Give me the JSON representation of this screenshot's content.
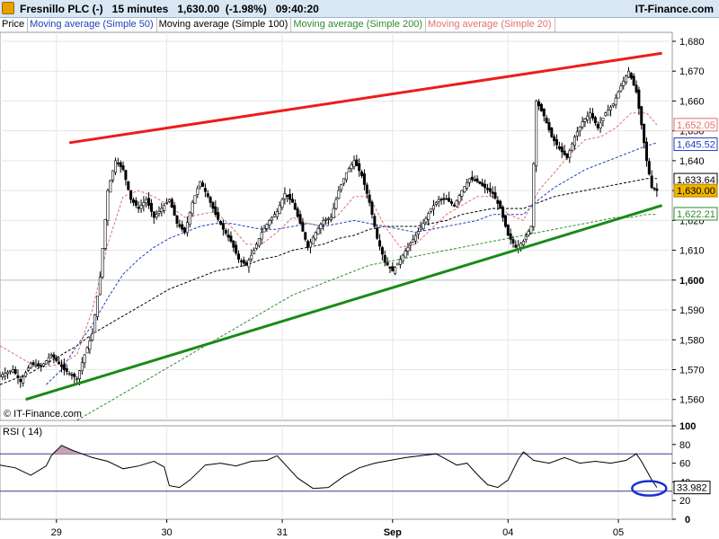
{
  "header": {
    "title": "Fresnillo PLC (-)   15 minutes   1,630.00  (-1.98%)   09:40:20",
    "brand": "IT-Finance.com"
  },
  "legend": [
    {
      "label": "Price",
      "color": "#000000"
    },
    {
      "label": "Moving average (Simple 50)",
      "color": "#1f3fbf"
    },
    {
      "label": "Moving average (Simple 100)",
      "color": "#000000"
    },
    {
      "label": "Moving average (Simple 200)",
      "color": "#2e8b2e"
    },
    {
      "label": "Moving average (Simple 20)",
      "color": "#e07070"
    }
  ],
  "watermark": "© IT-Finance.com",
  "chart_data": [
    {
      "type": "candlestick",
      "ylim": [
        1553,
        1683
      ],
      "y_ticks": [
        "1,560",
        "1,570",
        "1,580",
        "1,590",
        "1,600",
        "1,610",
        "1,620",
        "1,630",
        "1,640",
        "1,650",
        "1,660",
        "1,670",
        "1,680"
      ],
      "x_ticks": [
        "29",
        "30",
        "31",
        "Sep",
        "04",
        "05"
      ],
      "grid": true,
      "price_labels": [
        {
          "text": "1,652.05",
          "color": "#e07070"
        },
        {
          "text": "1,645.52",
          "color": "#1f3fbf"
        },
        {
          "text": "1,633.64",
          "color": "#000000"
        },
        {
          "text": "1,630.00",
          "color": "#000000",
          "bg": "#f0b400"
        },
        {
          "text": "1,622.21",
          "color": "#2e8b2e"
        }
      ],
      "price_path": [
        [
          0,
          1568
        ],
        [
          5,
          1570
        ],
        [
          8,
          1566
        ],
        [
          12,
          1572
        ],
        [
          16,
          1571
        ],
        [
          20,
          1575
        ],
        [
          25,
          1570
        ],
        [
          30,
          1567
        ],
        [
          33,
          1575
        ],
        [
          36,
          1582
        ],
        [
          39,
          1601
        ],
        [
          42,
          1630
        ],
        [
          45,
          1640
        ],
        [
          48,
          1637
        ],
        [
          51,
          1627
        ],
        [
          54,
          1624
        ],
        [
          57,
          1627
        ],
        [
          60,
          1621
        ],
        [
          63,
          1624
        ],
        [
          66,
          1627
        ],
        [
          69,
          1619
        ],
        [
          72,
          1616
        ],
        [
          75,
          1626
        ],
        [
          78,
          1633
        ],
        [
          81,
          1628
        ],
        [
          84,
          1622
        ],
        [
          87,
          1617
        ],
        [
          90,
          1613
        ],
        [
          93,
          1607
        ],
        [
          96,
          1605
        ],
        [
          99,
          1610
        ],
        [
          102,
          1616
        ],
        [
          105,
          1620
        ],
        [
          108,
          1623
        ],
        [
          111,
          1629
        ],
        [
          114,
          1626
        ],
        [
          117,
          1619
        ],
        [
          120,
          1611
        ],
        [
          123,
          1616
        ],
        [
          126,
          1620
        ],
        [
          129,
          1621
        ],
        [
          132,
          1630
        ],
        [
          135,
          1636
        ],
        [
          138,
          1640
        ],
        [
          141,
          1635
        ],
        [
          144,
          1626
        ],
        [
          147,
          1614
        ],
        [
          150,
          1606
        ],
        [
          153,
          1603
        ],
        [
          156,
          1607
        ],
        [
          159,
          1611
        ],
        [
          162,
          1615
        ],
        [
          165,
          1619
        ],
        [
          168,
          1624
        ],
        [
          171,
          1627
        ],
        [
          174,
          1627
        ],
        [
          177,
          1625
        ],
        [
          180,
          1630
        ],
        [
          183,
          1634
        ],
        [
          186,
          1633
        ],
        [
          189,
          1631
        ],
        [
          192,
          1629
        ],
        [
          195,
          1624
        ],
        [
          198,
          1615
        ],
        [
          201,
          1611
        ],
        [
          204,
          1613
        ],
        [
          207,
          1618
        ],
        [
          209,
          1660
        ],
        [
          212,
          1655
        ],
        [
          215,
          1648
        ],
        [
          218,
          1644
        ],
        [
          221,
          1641
        ],
        [
          224,
          1648
        ],
        [
          227,
          1653
        ],
        [
          230,
          1656
        ],
        [
          233,
          1651
        ],
        [
          236,
          1656
        ],
        [
          239,
          1659
        ],
        [
          242,
          1665
        ],
        [
          245,
          1670
        ],
        [
          248,
          1663
        ],
        [
          250,
          1652
        ],
        [
          252,
          1640
        ],
        [
          254,
          1631
        ],
        [
          256,
          1630
        ]
      ],
      "ma20_path": [
        [
          0,
          1578
        ],
        [
          6,
          1575
        ],
        [
          12,
          1572
        ],
        [
          18,
          1571
        ],
        [
          24,
          1572
        ],
        [
          30,
          1575
        ],
        [
          36,
          1590
        ],
        [
          42,
          1612
        ],
        [
          48,
          1628
        ],
        [
          54,
          1630
        ],
        [
          60,
          1628
        ],
        [
          66,
          1625
        ],
        [
          72,
          1621
        ],
        [
          78,
          1622
        ],
        [
          84,
          1623
        ],
        [
          90,
          1618
        ],
        [
          96,
          1612
        ],
        [
          102,
          1612
        ],
        [
          108,
          1616
        ],
        [
          114,
          1621
        ],
        [
          120,
          1619
        ],
        [
          126,
          1618
        ],
        [
          132,
          1622
        ],
        [
          138,
          1628
        ],
        [
          144,
          1628
        ],
        [
          150,
          1618
        ],
        [
          156,
          1611
        ],
        [
          162,
          1612
        ],
        [
          168,
          1617
        ],
        [
          174,
          1622
        ],
        [
          180,
          1625
        ],
        [
          186,
          1628
        ],
        [
          192,
          1628
        ],
        [
          198,
          1622
        ],
        [
          204,
          1620
        ],
        [
          210,
          1630
        ],
        [
          216,
          1636
        ],
        [
          222,
          1642
        ],
        [
          228,
          1647
        ],
        [
          234,
          1648
        ],
        [
          240,
          1651
        ],
        [
          246,
          1656
        ],
        [
          252,
          1656
        ],
        [
          256,
          1652
        ]
      ],
      "ma50_path": [
        [
          18,
          1565
        ],
        [
          24,
          1570
        ],
        [
          30,
          1578
        ],
        [
          36,
          1585
        ],
        [
          42,
          1594
        ],
        [
          48,
          1602
        ],
        [
          54,
          1607
        ],
        [
          60,
          1611
        ],
        [
          66,
          1614
        ],
        [
          72,
          1616
        ],
        [
          78,
          1618
        ],
        [
          84,
          1619
        ],
        [
          90,
          1619
        ],
        [
          96,
          1618
        ],
        [
          102,
          1617
        ],
        [
          108,
          1617
        ],
        [
          114,
          1618
        ],
        [
          120,
          1619
        ],
        [
          126,
          1618
        ],
        [
          132,
          1619
        ],
        [
          138,
          1620
        ],
        [
          144,
          1619
        ],
        [
          150,
          1618
        ],
        [
          156,
          1617
        ],
        [
          162,
          1616
        ],
        [
          168,
          1617
        ],
        [
          174,
          1618
        ],
        [
          180,
          1619
        ],
        [
          186,
          1620
        ],
        [
          192,
          1622
        ],
        [
          198,
          1622
        ],
        [
          204,
          1622
        ],
        [
          210,
          1627
        ],
        [
          216,
          1631
        ],
        [
          222,
          1634
        ],
        [
          228,
          1637
        ],
        [
          234,
          1639
        ],
        [
          240,
          1641
        ],
        [
          246,
          1643
        ],
        [
          252,
          1645
        ],
        [
          256,
          1646
        ]
      ],
      "ma100_path": [
        [
          0,
          1565
        ],
        [
          6,
          1567
        ],
        [
          12,
          1569
        ],
        [
          18,
          1572
        ],
        [
          24,
          1575
        ],
        [
          30,
          1578
        ],
        [
          36,
          1582
        ],
        [
          42,
          1585
        ],
        [
          48,
          1588
        ],
        [
          54,
          1591
        ],
        [
          60,
          1594
        ],
        [
          66,
          1597
        ],
        [
          72,
          1599
        ],
        [
          78,
          1601
        ],
        [
          84,
          1603
        ],
        [
          90,
          1604
        ],
        [
          96,
          1605
        ],
        [
          102,
          1607
        ],
        [
          108,
          1608
        ],
        [
          114,
          1610
        ],
        [
          120,
          1611
        ],
        [
          126,
          1612
        ],
        [
          132,
          1614
        ],
        [
          138,
          1615
        ],
        [
          144,
          1617
        ],
        [
          150,
          1618
        ],
        [
          156,
          1618
        ],
        [
          162,
          1618
        ],
        [
          168,
          1619
        ],
        [
          174,
          1620
        ],
        [
          180,
          1622
        ],
        [
          186,
          1623
        ],
        [
          192,
          1624
        ],
        [
          198,
          1624
        ],
        [
          204,
          1624
        ],
        [
          210,
          1626
        ],
        [
          216,
          1628
        ],
        [
          222,
          1629
        ],
        [
          228,
          1630
        ],
        [
          234,
          1631
        ],
        [
          240,
          1632
        ],
        [
          246,
          1633
        ],
        [
          252,
          1634
        ],
        [
          256,
          1634
        ]
      ],
      "ma200_path": [
        [
          30,
          1553
        ],
        [
          36,
          1556
        ],
        [
          42,
          1559
        ],
        [
          48,
          1562
        ],
        [
          54,
          1565
        ],
        [
          60,
          1568
        ],
        [
          66,
          1571
        ],
        [
          72,
          1574
        ],
        [
          78,
          1577
        ],
        [
          84,
          1580
        ],
        [
          90,
          1583
        ],
        [
          96,
          1586
        ],
        [
          102,
          1589
        ],
        [
          108,
          1592
        ],
        [
          114,
          1595
        ],
        [
          120,
          1597
        ],
        [
          126,
          1599
        ],
        [
          132,
          1601
        ],
        [
          138,
          1603
        ],
        [
          144,
          1605
        ],
        [
          150,
          1606
        ],
        [
          156,
          1607
        ],
        [
          162,
          1608
        ],
        [
          168,
          1609
        ],
        [
          174,
          1610
        ],
        [
          180,
          1611
        ],
        [
          186,
          1612
        ],
        [
          192,
          1613
        ],
        [
          198,
          1614
        ],
        [
          204,
          1615
        ],
        [
          210,
          1616
        ],
        [
          216,
          1617
        ],
        [
          222,
          1618
        ],
        [
          228,
          1619
        ],
        [
          234,
          1620
        ],
        [
          240,
          1621
        ],
        [
          246,
          1621
        ],
        [
          252,
          1622
        ],
        [
          256,
          1622
        ]
      ],
      "support_line": [
        [
          10,
          1560
        ],
        [
          258,
          1625
        ]
      ],
      "resistance_line": [
        [
          27,
          1646
        ],
        [
          258,
          1676
        ]
      ]
    },
    {
      "type": "line",
      "title": "RSI ( 14)",
      "ylim": [
        0,
        100
      ],
      "y_ticks": [
        "0",
        "20",
        "40",
        "60",
        "80",
        "100"
      ],
      "levels": [
        30,
        70
      ],
      "last_value": "33.982",
      "values": [
        [
          0,
          58
        ],
        [
          6,
          55
        ],
        [
          12,
          47
        ],
        [
          18,
          57
        ],
        [
          20,
          68
        ],
        [
          24,
          79
        ],
        [
          28,
          74
        ],
        [
          32,
          70
        ],
        [
          36,
          66
        ],
        [
          42,
          62
        ],
        [
          48,
          54
        ],
        [
          54,
          57
        ],
        [
          60,
          62
        ],
        [
          64,
          56
        ],
        [
          66,
          36
        ],
        [
          70,
          34
        ],
        [
          74,
          42
        ],
        [
          80,
          58
        ],
        [
          86,
          60
        ],
        [
          92,
          57
        ],
        [
          98,
          62
        ],
        [
          104,
          63
        ],
        [
          108,
          68
        ],
        [
          112,
          56
        ],
        [
          116,
          44
        ],
        [
          122,
          33
        ],
        [
          128,
          34
        ],
        [
          134,
          46
        ],
        [
          140,
          55
        ],
        [
          146,
          60
        ],
        [
          152,
          63
        ],
        [
          158,
          66
        ],
        [
          164,
          68
        ],
        [
          170,
          70
        ],
        [
          174,
          64
        ],
        [
          178,
          58
        ],
        [
          182,
          60
        ],
        [
          186,
          48
        ],
        [
          190,
          37
        ],
        [
          194,
          34
        ],
        [
          198,
          42
        ],
        [
          202,
          64
        ],
        [
          204,
          72
        ],
        [
          208,
          63
        ],
        [
          214,
          60
        ],
        [
          220,
          66
        ],
        [
          226,
          60
        ],
        [
          232,
          62
        ],
        [
          238,
          60
        ],
        [
          244,
          63
        ],
        [
          248,
          70
        ],
        [
          250,
          62
        ],
        [
          252,
          52
        ],
        [
          254,
          42
        ],
        [
          256,
          34
        ]
      ]
    }
  ]
}
